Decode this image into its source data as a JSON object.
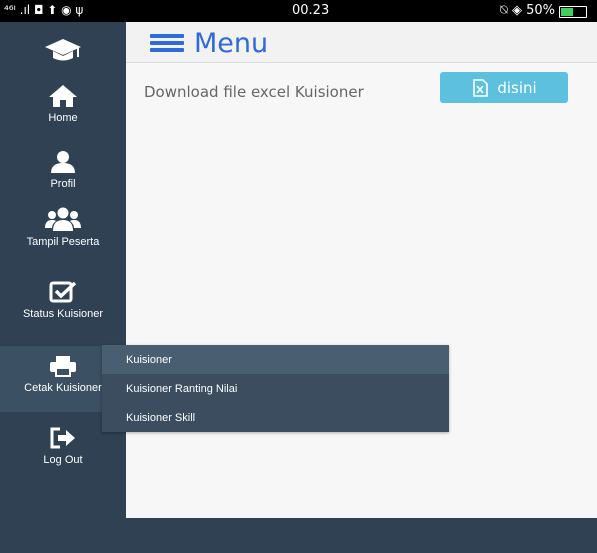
{
  "status_bar": {
    "left_icons": "⁴⁶ᴵ .ıl ◘ ⬆ ◉ ψ",
    "time": "00.23",
    "right_text": "⍉ ◈ 50%",
    "battery_color": "#3fd15c"
  },
  "header": {
    "title": "Menu"
  },
  "content": {
    "download_text": "Download file excel Kuisioner",
    "download_button_label": "disini"
  },
  "sidebar": {
    "items": [
      {
        "label": "Home",
        "icon": "home-icon"
      },
      {
        "label": "Profil",
        "icon": "user-icon"
      },
      {
        "label": "Tampil Peserta",
        "icon": "users-icon"
      },
      {
        "label": "Status Kuisioner",
        "icon": "checkbox-icon"
      },
      {
        "label": "Cetak Kuisioner",
        "icon": "printer-icon"
      },
      {
        "label": "Log Out",
        "icon": "logout-icon"
      }
    ]
  },
  "submenu": {
    "items": [
      {
        "label": "Kuisioner"
      },
      {
        "label": "Kuisioner Ranting Nilai"
      },
      {
        "label": "Kuisioner Skill"
      }
    ]
  },
  "colors": {
    "sidebar_bg": "#2f4152",
    "accent_blue": "#2e6ad8",
    "button_bg": "#5cc0de"
  }
}
